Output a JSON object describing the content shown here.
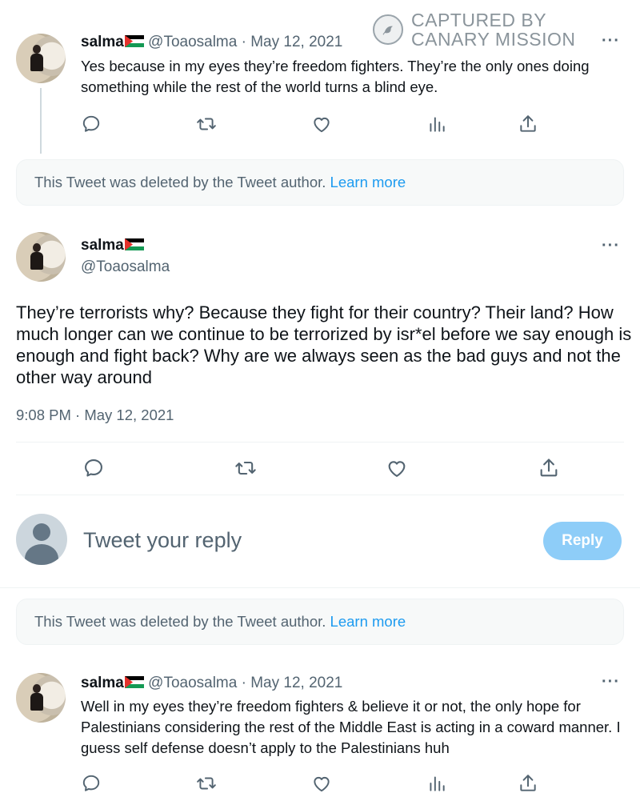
{
  "watermark": {
    "line1": "CAPTURED BY",
    "line2": "CANARY MISSION"
  },
  "tweet1": {
    "name": "salma",
    "handle": "@Toaosalma",
    "date": "May 12, 2021",
    "text": "Yes because in my eyes they’re freedom fighters. They’re the only ones doing something while the rest of the world turns a blind eye.",
    "more": "···"
  },
  "deleted1": {
    "text": "This Tweet was deleted by the Tweet author.",
    "link": "Learn more"
  },
  "main_tweet": {
    "name": "salma",
    "handle": "@Toaosalma",
    "text": "They’re terrorists why? Because they fight for their country? Their land? How much longer can we continue to be terrorized by isr*el before we say enough is enough and fight back? Why are we always seen as the bad guys and not the other way around",
    "timestamp": "9:08 PM · May 12, 2021",
    "more": "···"
  },
  "reply_box": {
    "placeholder": "Tweet your reply",
    "button": "Reply"
  },
  "deleted2": {
    "text": "This Tweet was deleted by the Tweet author.",
    "link": "Learn more"
  },
  "tweet3": {
    "name": "salma",
    "handle": "@Toaosalma",
    "date": "May 12, 2021",
    "text": "Well in my eyes they’re freedom fighters & believe it or not, the only hope for Palestinians considering the rest of the Middle East is acting in a coward manner. I guess self defense doesn’t apply to the Palestinians huh",
    "more": "···"
  },
  "colors": {
    "accent": "#1d9bf0",
    "reply_button_disabled": "#8ecdf8",
    "muted": "#536471"
  },
  "icons": [
    "reply-icon",
    "retweet-icon",
    "like-icon",
    "views-icon",
    "share-icon",
    "palestine-flag-icon",
    "canary-icon"
  ]
}
